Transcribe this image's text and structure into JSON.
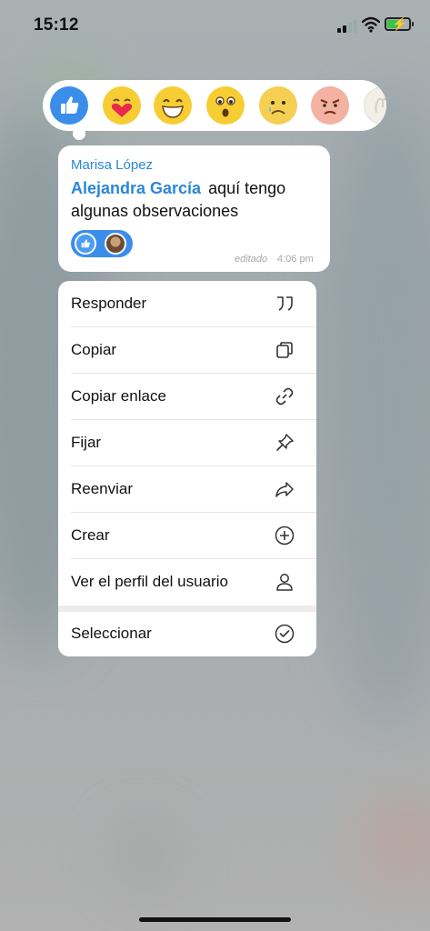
{
  "status_bar": {
    "time": "15:12"
  },
  "reactions": [
    {
      "name": "like",
      "icon": "thumbs-up-icon"
    },
    {
      "name": "love",
      "icon": "heart-face-icon"
    },
    {
      "name": "haha",
      "icon": "grin-face-icon"
    },
    {
      "name": "wow",
      "icon": "surprised-face-icon"
    },
    {
      "name": "sad",
      "icon": "sad-face-icon"
    },
    {
      "name": "angry",
      "icon": "angry-face-icon"
    },
    {
      "name": "more",
      "icon": "more-reactions-icon"
    }
  ],
  "message": {
    "sender": "Marisa López",
    "mention": "Alejandra García",
    "text_line1": "aquí tengo",
    "text_line2": "algunas observaciones",
    "edited_label": "editado",
    "time": "4:06 pm",
    "reaction_chip": {
      "icon": "thumbs-up-icon",
      "avatar": "reactor-avatar"
    }
  },
  "menu": {
    "items": [
      {
        "label": "Responder",
        "icon": "quote-icon"
      },
      {
        "label": "Copiar",
        "icon": "copy-icon"
      },
      {
        "label": "Copiar enlace",
        "icon": "link-icon"
      },
      {
        "label": "Fijar",
        "icon": "pin-icon"
      },
      {
        "label": "Reenviar",
        "icon": "forward-icon"
      },
      {
        "label": "Crear",
        "icon": "plus-circle-icon"
      },
      {
        "label": "Ver el perfil del usuario",
        "icon": "user-icon"
      },
      {
        "label": "Seleccionar",
        "icon": "check-circle-icon"
      }
    ]
  },
  "colors": {
    "accent": "#2c86d8",
    "like_blue": "#3a8eea",
    "battery_green": "#3ac24b"
  }
}
